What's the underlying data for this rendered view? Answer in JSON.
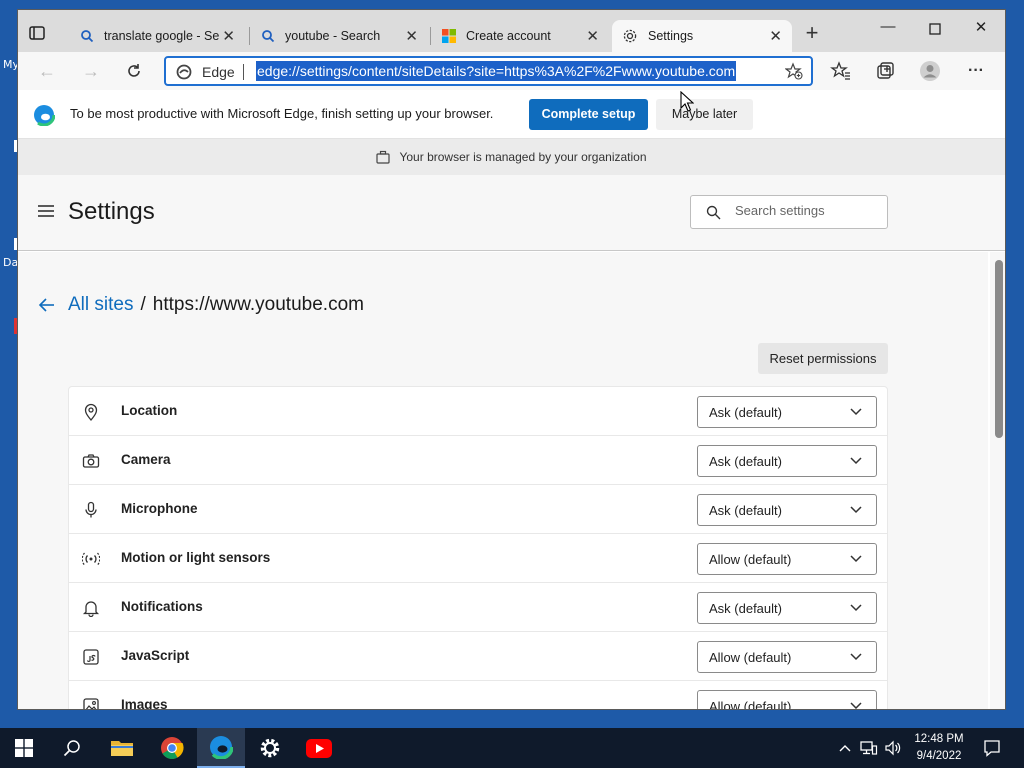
{
  "desktop": {
    "labels": [
      "My",
      "Da"
    ]
  },
  "tabs": [
    {
      "title": "translate google - Sea",
      "icon": "search-icon"
    },
    {
      "title": "youtube - Search",
      "icon": "search-icon"
    },
    {
      "title": "Create account",
      "icon": "microsoft-logo-icon"
    },
    {
      "title": "Settings",
      "icon": "gear-icon",
      "active": true
    }
  ],
  "address_bar": {
    "identity": "Edge",
    "url": "edge://settings/content/siteDetails?site=https%3A%2F%2Fwww.youtube.com"
  },
  "banner": {
    "text": "To be most productive with Microsoft Edge, finish setting up your browser.",
    "primary": "Complete setup",
    "secondary": "Maybe later"
  },
  "managed": {
    "text": "Your browser is managed by your organization"
  },
  "settings": {
    "title": "Settings",
    "search_placeholder": "Search settings"
  },
  "breadcrumb": {
    "parent": "All sites",
    "separator": "/",
    "current": "https://www.youtube.com"
  },
  "reset_label": "Reset permissions",
  "permissions": [
    {
      "label": "Location",
      "value": "Ask (default)",
      "icon": "location-pin-icon"
    },
    {
      "label": "Camera",
      "value": "Ask (default)",
      "icon": "camera-icon"
    },
    {
      "label": "Microphone",
      "value": "Ask (default)",
      "icon": "microphone-icon"
    },
    {
      "label": "Motion or light sensors",
      "value": "Allow (default)",
      "icon": "sensor-icon"
    },
    {
      "label": "Notifications",
      "value": "Ask (default)",
      "icon": "bell-icon"
    },
    {
      "label": "JavaScript",
      "value": "Allow (default)",
      "icon": "javascript-icon"
    },
    {
      "label": "Images",
      "value": "Allow (default)",
      "icon": "image-icon"
    }
  ],
  "taskbar": {
    "time": "12:48 PM",
    "date": "9/4/2022"
  },
  "colors": {
    "accent": "#0f6cbd",
    "selection": "#1d61c9",
    "taskbar": "#0f1a2b",
    "desktop": "#1e5aa8"
  }
}
